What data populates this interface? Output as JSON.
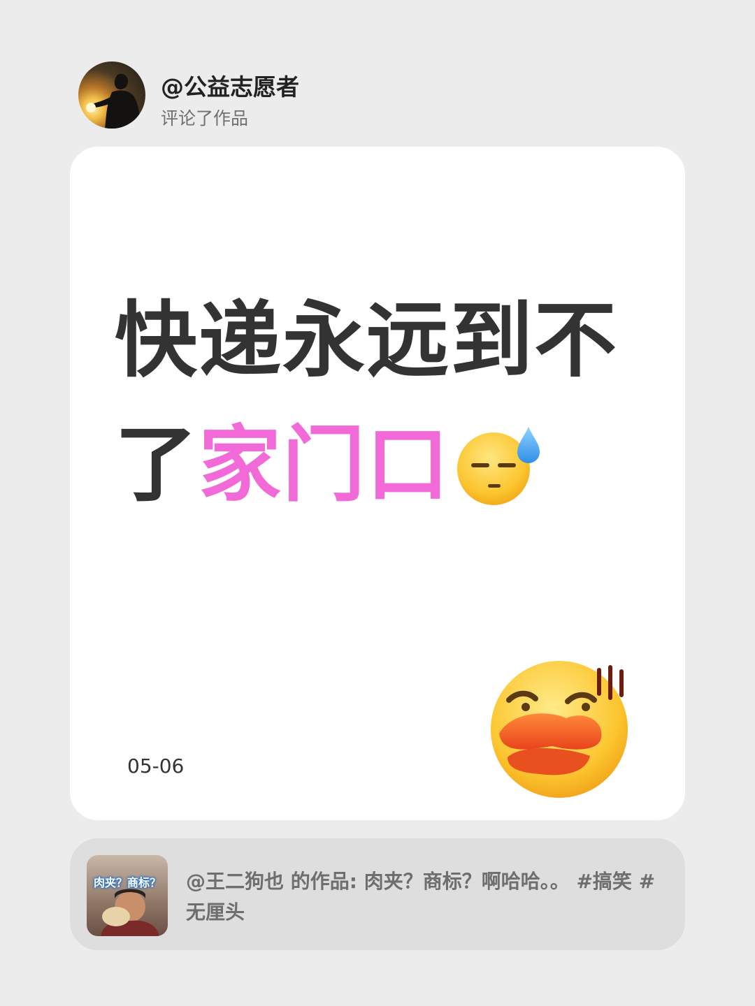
{
  "header": {
    "user_name": "@公益志愿者",
    "action": "评论了作品",
    "avatar_icon": "silhouette-sunset-avatar"
  },
  "card": {
    "line1": "快递永远到不",
    "line2_dark": "了",
    "line2_pink": "家门口",
    "accent_color": "#f26ad7",
    "text_color": "#333333",
    "emoji_inline": "downcast-face-with-sweat-icon",
    "emoji_corner": "duck-lips-face-icon",
    "date": "05-06"
  },
  "source": {
    "thumb_caption": "肉夹？商标？",
    "text": "@王二狗也 的作品: 肉夹？商标？啊哈哈。。 #搞笑 #无厘头"
  }
}
